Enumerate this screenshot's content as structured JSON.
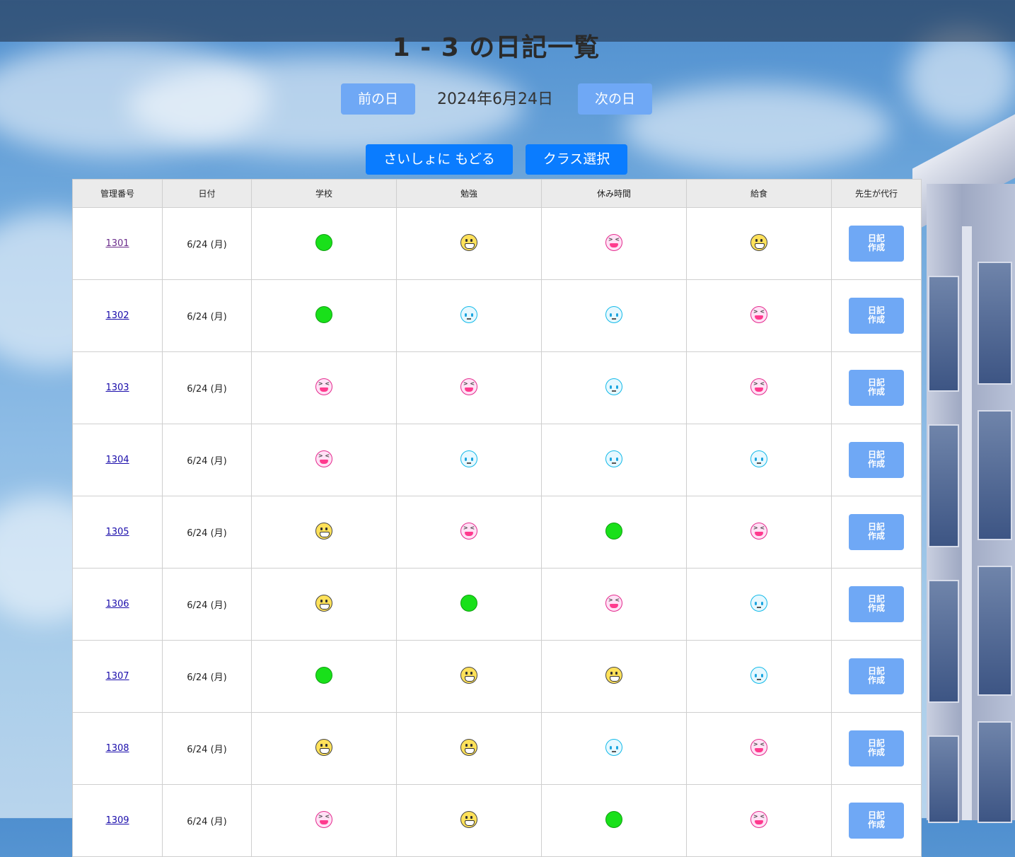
{
  "page": {
    "title": "1 - 3 の日記一覧",
    "date": "2024年6月24日",
    "prev_label": "前の日",
    "next_label": "次の日",
    "home_label": "さいしょに もどる",
    "class_select_label": "クラス選択"
  },
  "table": {
    "headers": [
      "管理番号",
      "日付",
      "学校",
      "勉強",
      "休み時間",
      "給食",
      "先生が代行"
    ],
    "create_label_line1": "日記",
    "create_label_line2": "作成",
    "rows": [
      {
        "id": "1301",
        "date": "6/24 (月)",
        "moods": [
          "green",
          "happy",
          "laugh",
          "happy"
        ],
        "visited": true
      },
      {
        "id": "1302",
        "date": "6/24 (月)",
        "moods": [
          "green",
          "cry",
          "cry",
          "laugh"
        ],
        "visited": false
      },
      {
        "id": "1303",
        "date": "6/24 (月)",
        "moods": [
          "laugh",
          "laugh",
          "cry",
          "laugh"
        ],
        "visited": false
      },
      {
        "id": "1304",
        "date": "6/24 (月)",
        "moods": [
          "laugh",
          "cry",
          "cry",
          "cry"
        ],
        "visited": false
      },
      {
        "id": "1305",
        "date": "6/24 (月)",
        "moods": [
          "happy",
          "laugh",
          "green",
          "laugh"
        ],
        "visited": false
      },
      {
        "id": "1306",
        "date": "6/24 (月)",
        "moods": [
          "happy",
          "green",
          "laugh",
          "cry"
        ],
        "visited": false
      },
      {
        "id": "1307",
        "date": "6/24 (月)",
        "moods": [
          "green",
          "happy",
          "happy",
          "cry"
        ],
        "visited": false
      },
      {
        "id": "1308",
        "date": "6/24 (月)",
        "moods": [
          "happy",
          "happy",
          "cry",
          "laugh"
        ],
        "visited": false
      },
      {
        "id": "1309",
        "date": "6/24 (月)",
        "moods": [
          "laugh",
          "happy",
          "green",
          "laugh"
        ],
        "visited": false
      }
    ]
  },
  "icons": {
    "green": "green-circle-icon",
    "happy": "grinning-face-icon",
    "laugh": "laughing-face-icon",
    "cry": "crying-face-icon"
  },
  "colors": {
    "button_light": "#6fa8f5",
    "button_blue": "#0a7cff",
    "header_bg": "#ebebeb"
  }
}
